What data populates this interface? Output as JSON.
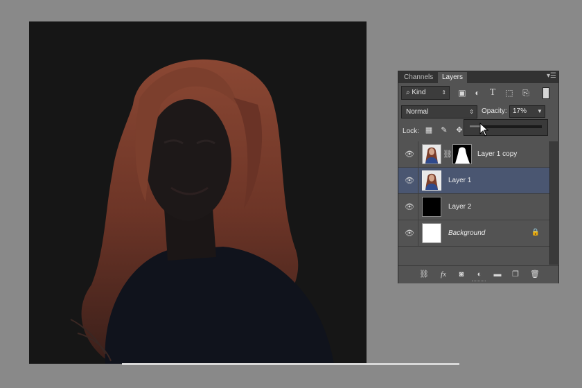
{
  "panel": {
    "tabs": [
      {
        "label": "Channels",
        "active": false
      },
      {
        "label": "Layers",
        "active": true
      }
    ],
    "menu_icon": "panel-menu-icon"
  },
  "filter": {
    "kind_label": "Kind",
    "icons": [
      "image-filter-icon",
      "adjustment-filter-icon",
      "type-filter-icon",
      "shape-filter-icon",
      "smart-object-filter-icon"
    ]
  },
  "blend": {
    "mode": "Normal",
    "opacity_label": "Opacity:",
    "opacity_value": "17%",
    "opacity_fraction": 0.17
  },
  "lock": {
    "label": "Lock:",
    "icons": [
      "lock-transparent-pixels-icon",
      "lock-image-pixels-icon",
      "lock-position-icon"
    ]
  },
  "layers": [
    {
      "name": "Layer 1 copy",
      "visible": true,
      "selected": false,
      "has_mask": true,
      "thumbnail": "woman-photo"
    },
    {
      "name": "Layer 1",
      "visible": true,
      "selected": true,
      "has_mask": false,
      "thumbnail": "woman-photo"
    },
    {
      "name": "Layer 2",
      "visible": true,
      "selected": false,
      "has_mask": false,
      "thumbnail": "black-fill"
    },
    {
      "name": "Background",
      "visible": true,
      "selected": false,
      "has_mask": false,
      "thumbnail": "white-fill",
      "locked": true
    }
  ],
  "bottom_icons": [
    "link-layers-icon",
    "fx-icon",
    "add-mask-icon",
    "adjustment-layer-icon",
    "group-folder-icon",
    "new-layer-icon",
    "trash-icon"
  ],
  "colors": {
    "workspace": "#898989",
    "panel_bg": "#535353",
    "selected_row": "#4a5671",
    "hair": "#7a3f2e"
  }
}
